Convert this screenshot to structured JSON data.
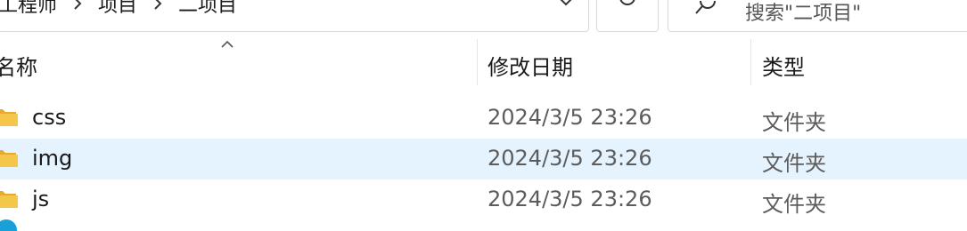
{
  "breadcrumbs": [
    "工程师",
    "项目",
    "二项目"
  ],
  "search": {
    "placeholder": "搜索\"二项目\""
  },
  "columns": {
    "name": "名称",
    "date": "修改日期",
    "type": "类型"
  },
  "rows": [
    {
      "name": "css",
      "date": "2024/3/5 23:26",
      "type": "文件夹",
      "icon": "folder-icon",
      "selected": false
    },
    {
      "name": "img",
      "date": "2024/3/5 23:26",
      "type": "文件夹",
      "icon": "folder-icon",
      "selected": true
    },
    {
      "name": "js",
      "date": "2024/3/5 23:26",
      "type": "文件夹",
      "icon": "folder-icon",
      "selected": false
    }
  ],
  "colors": {
    "selected_row": "#e5f3ff",
    "folder": "#f4c64a",
    "text_secondary": "#5c5c5c",
    "partial_icon": "#1aa0d8"
  }
}
